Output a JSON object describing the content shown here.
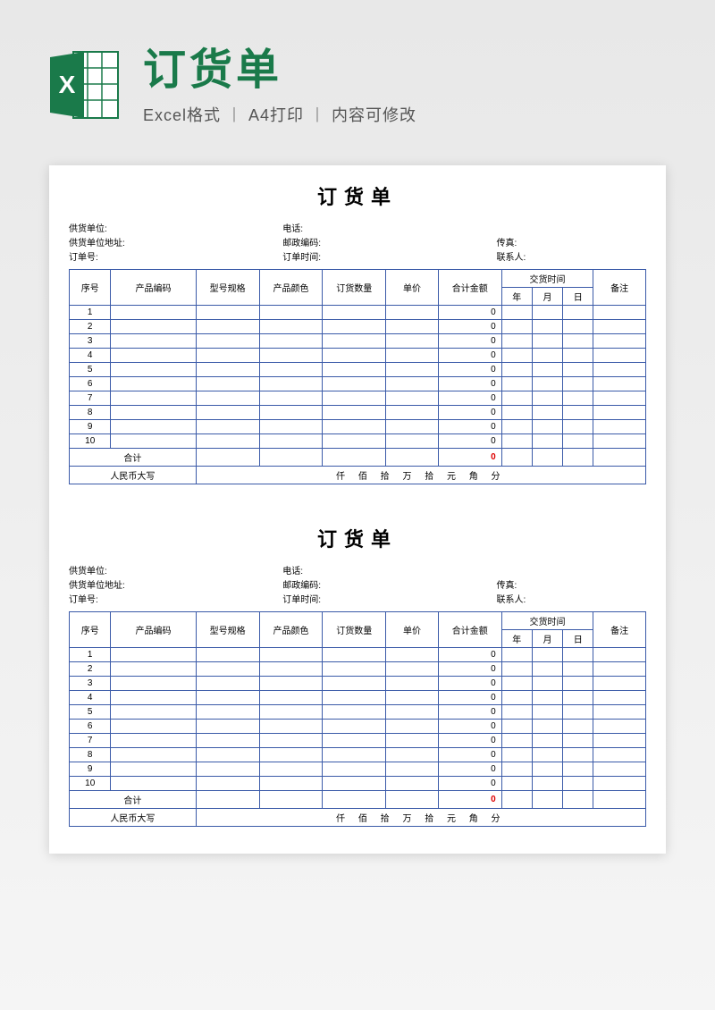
{
  "header": {
    "title": "订货单",
    "subtitle_parts": [
      "Excel格式",
      "A4打印",
      "内容可修改"
    ]
  },
  "form": {
    "title": "订货单",
    "meta": {
      "supplier_label": "供货单位:",
      "supplier": "",
      "phone_label": "电话:",
      "phone": "",
      "addr_label": "供货单位地址:",
      "addr": "",
      "zip_label": "邮政编码:",
      "zip": "",
      "fax_label": "传真:",
      "fax": "",
      "orderno_label": "订单号:",
      "orderno": "",
      "ordertime_label": "订单时间:",
      "ordertime": "",
      "contact_label": "联系人:",
      "contact": ""
    },
    "columns": {
      "seq": "序号",
      "code": "产品编码",
      "spec": "型号规格",
      "color": "产品颜色",
      "qty": "订货数量",
      "price": "单价",
      "amount": "合计金额",
      "delivery": "交货时间",
      "year": "年",
      "month": "月",
      "day": "日",
      "note": "备注"
    },
    "rows": [
      {
        "seq": "1",
        "amount": "0"
      },
      {
        "seq": "2",
        "amount": "0"
      },
      {
        "seq": "3",
        "amount": "0"
      },
      {
        "seq": "4",
        "amount": "0"
      },
      {
        "seq": "5",
        "amount": "0"
      },
      {
        "seq": "6",
        "amount": "0"
      },
      {
        "seq": "7",
        "amount": "0"
      },
      {
        "seq": "8",
        "amount": "0"
      },
      {
        "seq": "9",
        "amount": "0"
      },
      {
        "seq": "10",
        "amount": "0"
      }
    ],
    "total_label": "合计",
    "total_value": "0",
    "rmb_label": "人民币大写",
    "rmb_units": "仟  佰  拾  万  拾  元   角   分"
  }
}
